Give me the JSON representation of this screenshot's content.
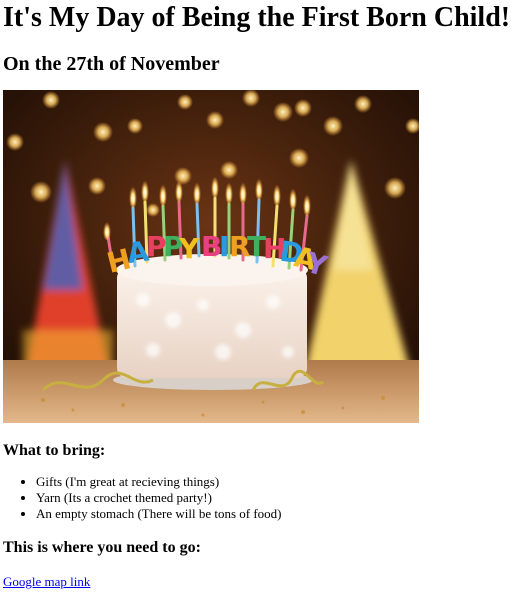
{
  "page": {
    "title": "It's My Day of Being the First Born Child!",
    "date_heading": "On the 27th of November"
  },
  "hero_image": {
    "sign_text": "HAPPY BIRTHDAY",
    "colors": {
      "background_dark": "#2a1408",
      "bokeh": "#ffd27a",
      "frosting": "#f3e6dc",
      "table": "#d9a876"
    }
  },
  "bring": {
    "heading": "What to bring:",
    "items": [
      "Gifts (I'm great at recieving things)",
      "Yarn (Its a crochet themed party!)",
      "An empty stomach (There will be tons of food)"
    ]
  },
  "location": {
    "heading": "This is where you need to go:",
    "link_text": "Google map link",
    "link_color": "#0000ee"
  }
}
